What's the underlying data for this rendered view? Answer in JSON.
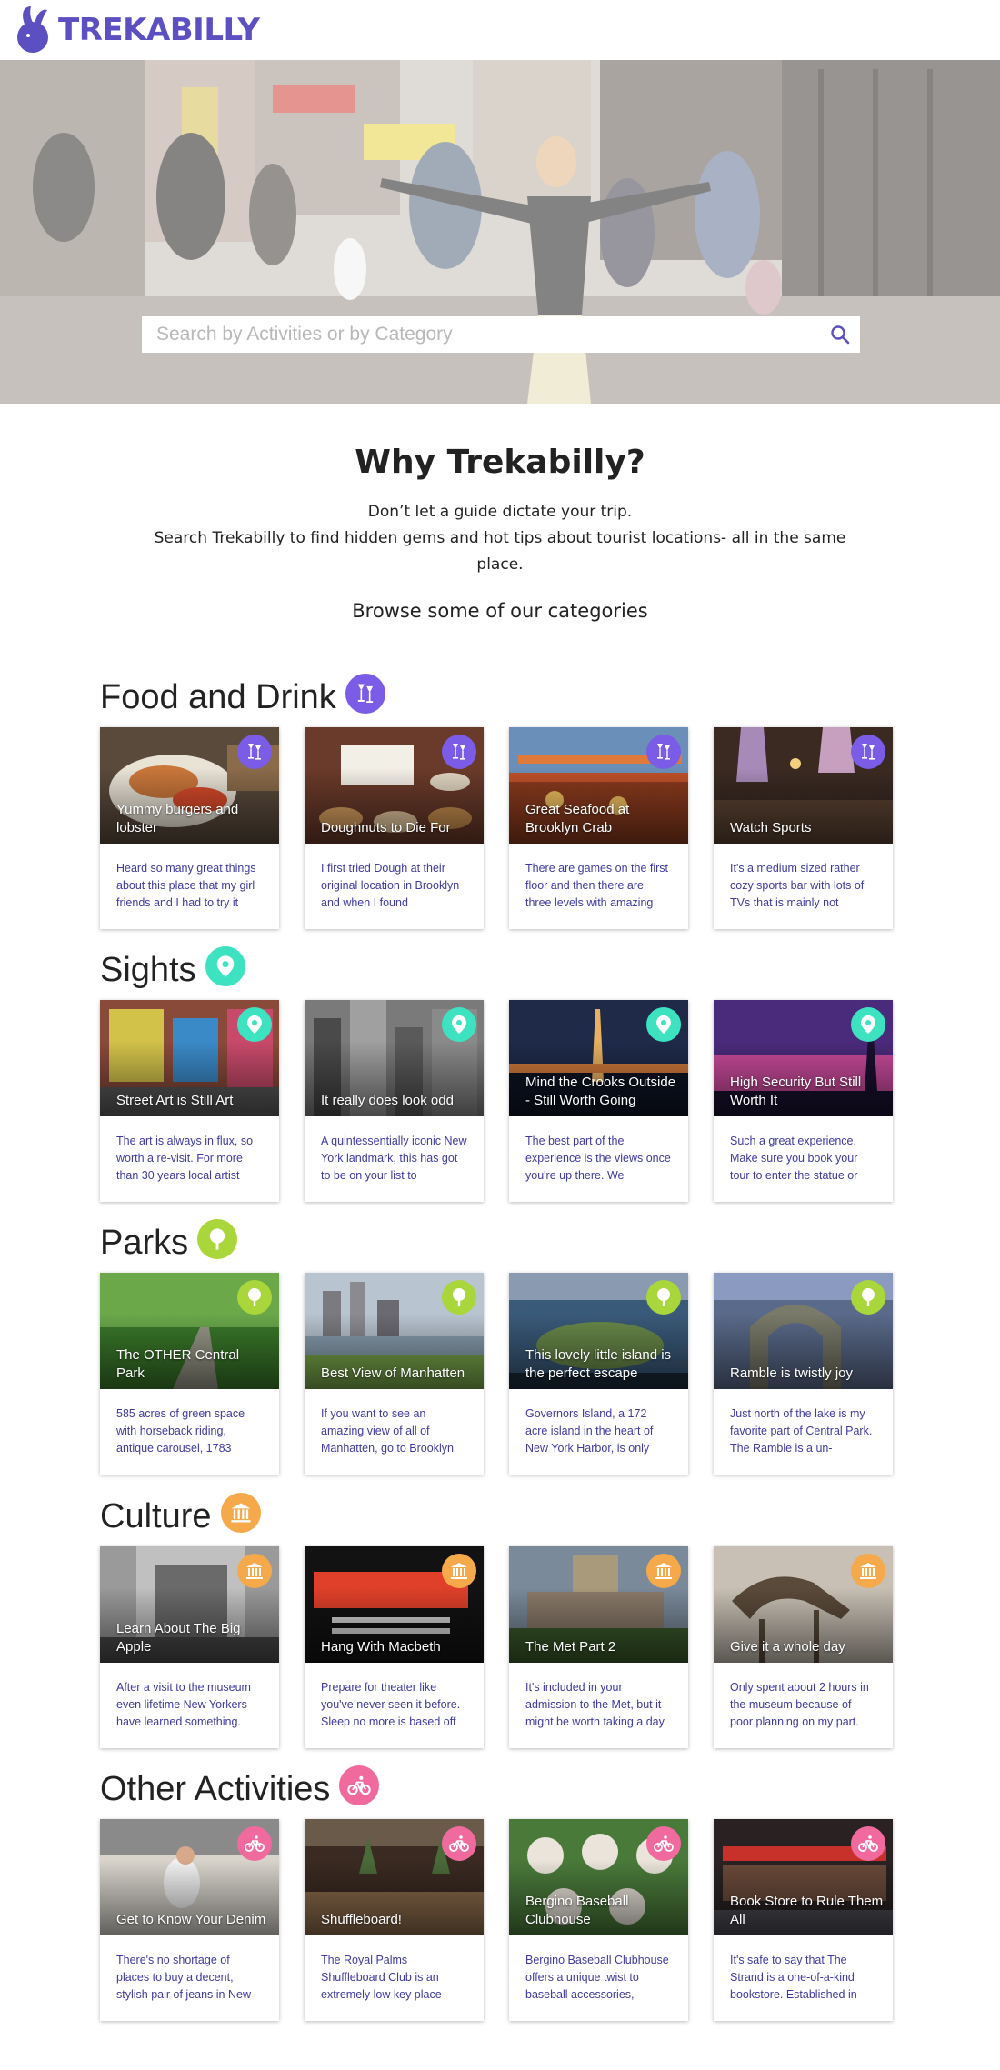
{
  "brand": {
    "logo_text": "TREKABILLY",
    "logo_icon": "rabbit-logo-icon",
    "accent": "#5b4fc2"
  },
  "search": {
    "placeholder": "Search by Activities or by Category",
    "value": "",
    "button_icon": "search-icon"
  },
  "why": {
    "title": "Why Trekabilly?",
    "line1": "Don’t let a guide dictate your trip.",
    "line2": "Search Trekabilly to find hidden gems and hot tips about tourist locations- all in the same place.",
    "browse": "Browse some of our categories"
  },
  "categories": [
    {
      "title": "Food and Drink",
      "icon": "cocktail-icon",
      "color": "#7b5ce6",
      "cards": [
        {
          "title": "Yummy burgers and lobster",
          "text": "Heard so many great things about this place that my girl friends and I had to try it"
        },
        {
          "title": "Doughnuts to Die For",
          "text": "I first tried Dough at their original location in Brooklyn and when I found"
        },
        {
          "title": "Great Seafood at Brooklyn Crab",
          "text": "There are games on the first floor and then there are three levels with amazing"
        },
        {
          "title": "Watch Sports",
          "text": "It's a medium sized rather cozy sports bar with lots of TVs that is mainly not"
        }
      ]
    },
    {
      "title": "Sights",
      "icon": "map-pin-icon",
      "color": "#3de3c1",
      "cards": [
        {
          "title": "Street Art is Still Art",
          "text": "The art is always in flux, so worth a re-visit. For more than 30 years local artist"
        },
        {
          "title": "It really does look odd",
          "text": "A quintessentially iconic New York landmark, this has got to be on your list to"
        },
        {
          "title": "Mind the Crooks Outside - Still Worth Going",
          "text": "The best part of the experience is the views once you're up there. We"
        },
        {
          "title": "High Security But Still Worth It",
          "text": "Such a great experience. Make sure you book your tour to enter the statue or"
        }
      ]
    },
    {
      "title": "Parks",
      "icon": "tree-icon",
      "color": "#a9d63a",
      "cards": [
        {
          "title": "The OTHER Central Park",
          "text": "585 acres of green space with horseback riding, antique carousel, 1783"
        },
        {
          "title": "Best View of Manhatten",
          "text": "If you want to see an amazing view of all of Manhatten, go to Brooklyn"
        },
        {
          "title": "This lovely little island is the perfect escape",
          "text": "Governors Island, a 172 acre island in the heart of New York Harbor, is only"
        },
        {
          "title": "Ramble is twistly joy",
          "text": "Just north of the lake is my favorite part of Central Park. The Ramble is a un-"
        }
      ]
    },
    {
      "title": "Culture",
      "icon": "museum-icon",
      "color": "#f6a94a",
      "cards": [
        {
          "title": "Learn About The Big Apple",
          "text": "After a visit to the museum even lifetime New Yorkers have learned something."
        },
        {
          "title": "Hang With Macbeth",
          "text": "Prepare for theater like you've never seen it before. Sleep no more is based off"
        },
        {
          "title": "The Met Part 2",
          "text": "It's included in your admission to the Met, but it might be worth taking a day"
        },
        {
          "title": "Give it a whole day",
          "text": "Only spent about 2 hours in the museum because of poor planning on my part."
        }
      ]
    },
    {
      "title": "Other Activities",
      "icon": "bicycle-icon",
      "color": "#f06a9e",
      "cards": [
        {
          "title": "Get to Know Your Denim",
          "text": "There's no shortage of places to buy a decent, stylish pair of jeans in New"
        },
        {
          "title": "Shuffleboard!",
          "text": "The Royal Palms Shuffleboard Club is an extremely low key place"
        },
        {
          "title": "Bergino Baseball Clubhouse",
          "text": "Bergino Baseball Clubhouse offers a unique twist to baseball accessories,"
        },
        {
          "title": "Book Store to Rule Them All",
          "text": "It's safe to say that The Strand is a one-of-a-kind bookstore. Established in"
        }
      ]
    }
  ]
}
